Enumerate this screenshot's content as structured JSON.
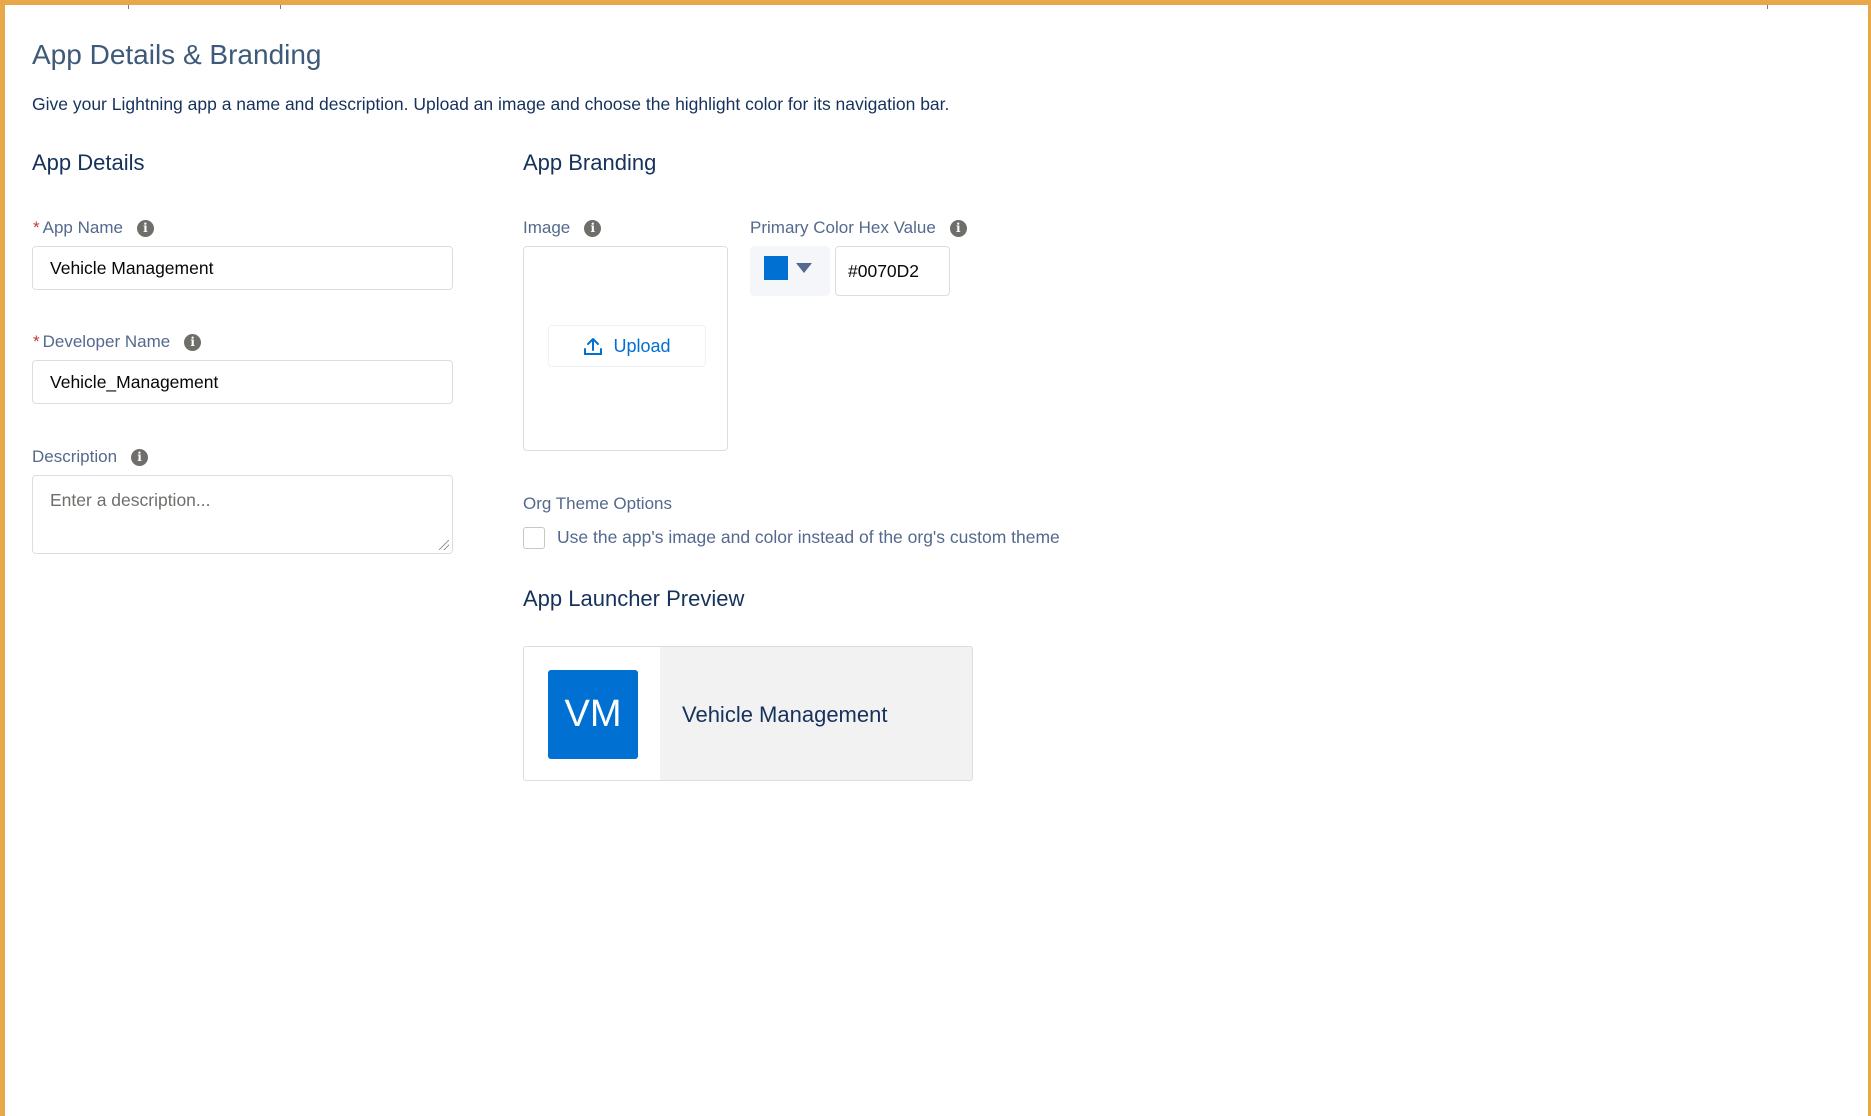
{
  "page": {
    "title": "App Details & Branding",
    "description": "Give your Lightning app a name and description. Upload an image and choose the highlight color for its navigation bar."
  },
  "app_details": {
    "section_title": "App Details",
    "required_marker": "*",
    "app_name": {
      "label": "App Name",
      "value": "Vehicle Management"
    },
    "developer_name": {
      "label": "Developer Name",
      "value": "Vehicle_Management"
    },
    "description": {
      "label": "Description",
      "placeholder": "Enter a description...",
      "value": ""
    }
  },
  "app_branding": {
    "section_title": "App Branding",
    "image": {
      "label": "Image",
      "upload_label": "Upload"
    },
    "primary_color": {
      "label": "Primary Color Hex Value",
      "value": "#0070D2",
      "swatch_color": "#0070d2"
    },
    "org_theme": {
      "label": "Org Theme Options",
      "checkbox_label": "Use the app's image and color instead of the org's custom theme",
      "checked": false
    }
  },
  "launcher_preview": {
    "section_title": "App Launcher Preview",
    "initials": "VM",
    "app_name": "Vehicle Management",
    "tile_color": "#0070d2"
  },
  "icons": {
    "info": "info-icon",
    "upload": "upload-icon",
    "dropdown": "caret-down-icon",
    "info_glyph": "i"
  }
}
